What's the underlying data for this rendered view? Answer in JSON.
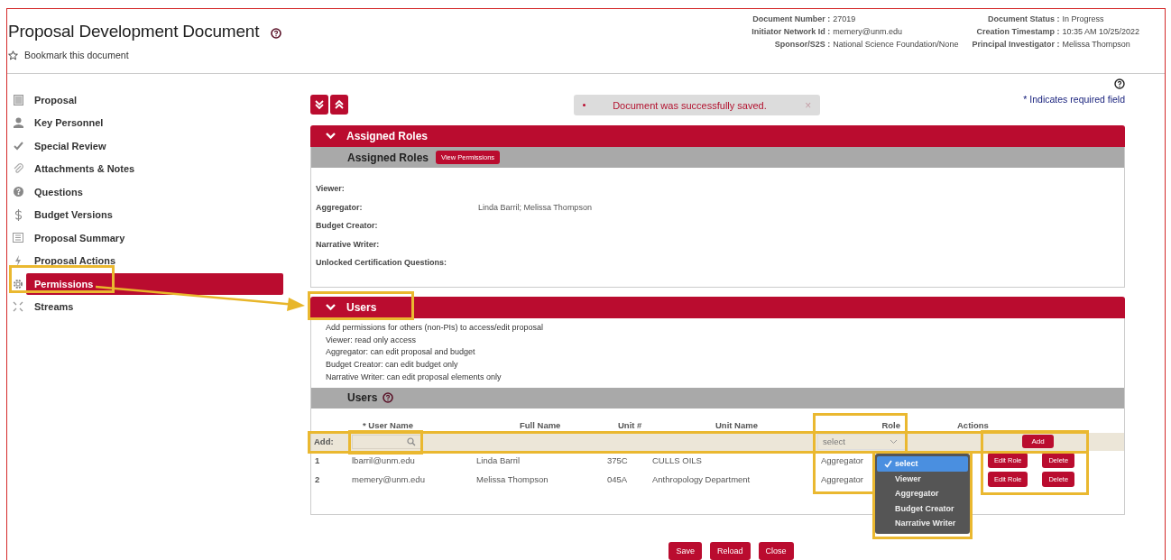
{
  "header": {
    "title": "Proposal Development Document",
    "bookmark": "Bookmark this document",
    "info": [
      {
        "label": "Document Number :",
        "value": "27019"
      },
      {
        "label": "Document Status :",
        "value": "In Progress"
      },
      {
        "label": "Initiator Network Id :",
        "value": "memery@unm.edu"
      },
      {
        "label": "Creation Timestamp :",
        "value": "10:35 AM 10/25/2022"
      },
      {
        "label": "Sponsor/S2S :",
        "value": "National Science Foundation/None"
      },
      {
        "label": "Principal Investigator :",
        "value": "Melissa Thompson"
      }
    ]
  },
  "sidebar": {
    "items": [
      {
        "label": "Proposal",
        "selected": false
      },
      {
        "label": "Key Personnel",
        "selected": false
      },
      {
        "label": "Special Review",
        "selected": false
      },
      {
        "label": "Attachments & Notes",
        "selected": false
      },
      {
        "label": "Questions",
        "selected": false
      },
      {
        "label": "Budget Versions",
        "selected": false
      },
      {
        "label": "Proposal Summary",
        "selected": false
      },
      {
        "label": "Proposal Actions",
        "selected": false
      },
      {
        "label": "Permissions",
        "selected": true
      },
      {
        "label": "Streams",
        "selected": false
      }
    ]
  },
  "message": {
    "text": "Document was successfully saved.",
    "close": "×"
  },
  "required_note": "* Indicates required field",
  "assigned_roles": {
    "title": "Assigned Roles",
    "subtitle": "Assigned Roles",
    "button": "View Permissions",
    "roles": [
      {
        "label": "Viewer:"
      },
      {
        "label": "Aggregator:",
        "value": "Linda Barril; Melissa Thompson"
      },
      {
        "label": "Budget Creator:"
      },
      {
        "label": "Narrative Writer:"
      },
      {
        "label": "Unlocked Certification Questions:"
      }
    ]
  },
  "users": {
    "title": "Users",
    "instructions": [
      "Add permissions for others (non-PIs) to access/edit proposal",
      "Viewer: read only access",
      "Aggregator: can edit proposal and budget",
      "Budget Creator: can edit budget only",
      "Narrative Writer: can edit proposal elements only"
    ],
    "subtitle": "Users",
    "columns": [
      "* User Name",
      "Full Name",
      "Unit #",
      "Unit Name",
      "Role",
      "Actions"
    ],
    "add_row": {
      "label": "Add:",
      "role_value": "select",
      "button": "Add"
    },
    "rows": [
      {
        "index": "1",
        "user_name": "lbarril@unm.edu",
        "full_name": "Linda Barril",
        "unit": "375C",
        "unit_name": "CULLS OILS",
        "role": "Aggregator",
        "actions": [
          "Edit Role",
          "Delete"
        ]
      },
      {
        "index": "2",
        "user_name": "memery@unm.edu",
        "full_name": "Melissa Thompson",
        "unit": "045A",
        "unit_name": "Anthropology Department",
        "role": "Aggregator",
        "actions": [
          "Edit Role",
          "Delete"
        ]
      }
    ],
    "role_menu": [
      {
        "label": "select",
        "selected": true
      },
      {
        "label": "Viewer",
        "selected": false
      },
      {
        "label": "Aggregator",
        "selected": false
      },
      {
        "label": "Budget Creator",
        "selected": false
      },
      {
        "label": "Narrative Writer",
        "selected": false
      }
    ]
  },
  "footer_buttons": [
    "Save",
    "Reload",
    "Close"
  ]
}
